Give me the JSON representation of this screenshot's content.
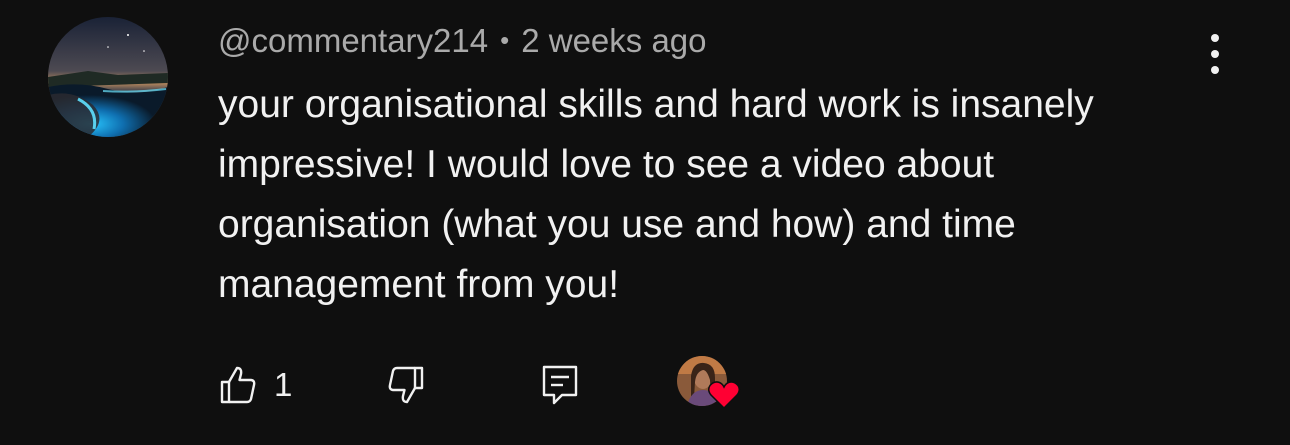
{
  "comment": {
    "author": "@commentary214",
    "separator": "•",
    "timestamp": "2 weeks ago",
    "text": "your organisational skills and hard work is insanely impressive! I would love to see a video about organisation (what you use and how) and time management from you!",
    "like_count": "1",
    "creator_heart": true
  },
  "icons": {
    "menu": "more-vert-icon",
    "like": "thumb-up-icon",
    "dislike": "thumb-down-icon",
    "reply": "reply-comment-icon",
    "heart": "heart-icon"
  },
  "colors": {
    "background": "#0f0f0f",
    "text": "#f1f1f1",
    "secondary_text": "#aaaaaa",
    "heart": "#ff0033"
  }
}
